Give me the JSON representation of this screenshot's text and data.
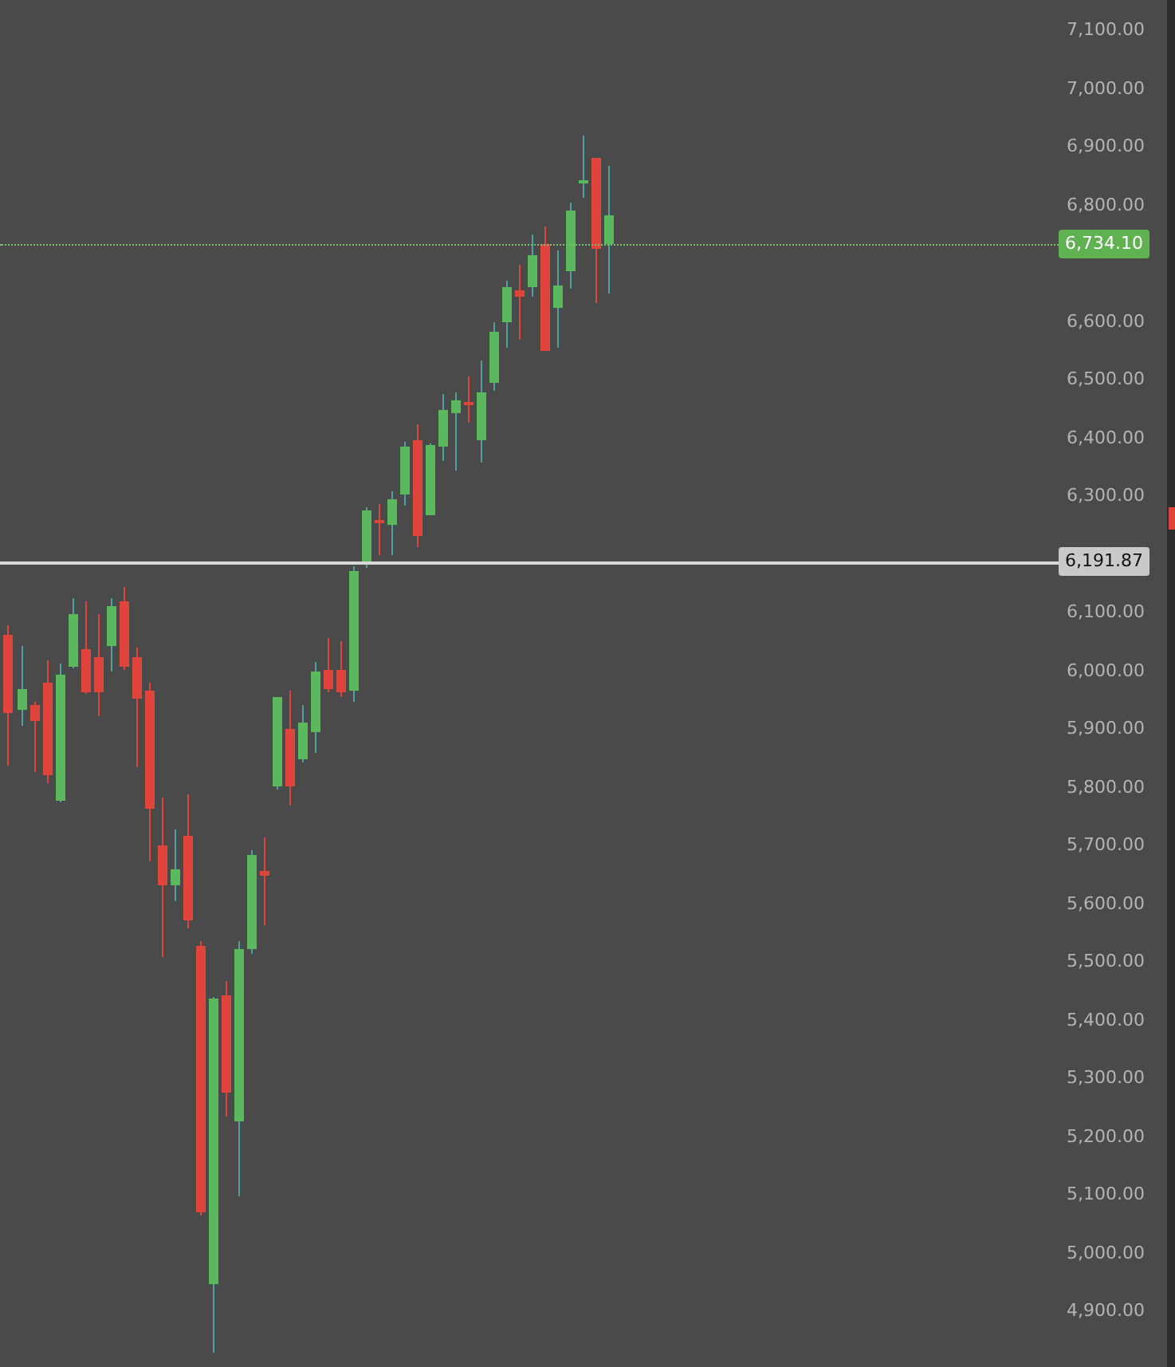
{
  "price_axis": {
    "ticks_upper": [
      "7,100.00",
      "7,000.00",
      "6,900.00",
      "6,800.00"
    ],
    "ticks_middle": [
      "6,600.00",
      "6,500.00",
      "6,400.00",
      "6,300.00"
    ],
    "ticks_lower": [
      "6,100.00",
      "6,000.00",
      "5,900.00",
      "5,800.00",
      "5,700.00",
      "5,600.00",
      "5,500.00",
      "5,400.00",
      "5,300.00",
      "5,200.00",
      "5,100.00",
      "5,000.00",
      "4,900.00"
    ]
  },
  "price_labels": [
    {
      "kind": "last",
      "text": "6,734.10"
    },
    {
      "kind": "line",
      "text": "6,191.87"
    }
  ]
}
